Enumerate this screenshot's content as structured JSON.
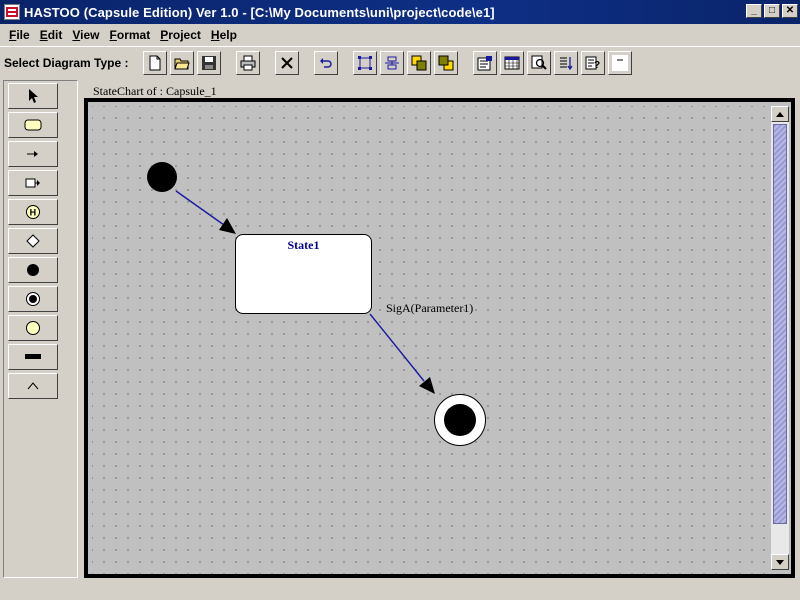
{
  "titlebar": {
    "title": "HASTOO (Capsule Edition) Ver 1.0 - [C:\\My Documents\\uni\\project\\code\\e1]",
    "minimize_glyph": "_",
    "maximize_glyph": "□",
    "close_glyph": "✕"
  },
  "menubar": {
    "items": [
      {
        "first": "F",
        "rest": "ile"
      },
      {
        "first": "E",
        "rest": "dit"
      },
      {
        "first": "V",
        "rest": "iew"
      },
      {
        "first": "F",
        "rest": "ormat"
      },
      {
        "first": "P",
        "rest": "roject"
      },
      {
        "first": "H",
        "rest": "elp"
      }
    ]
  },
  "toolbar": {
    "label": "Select Diagram Type :",
    "icons": [
      "new-file-icon",
      "open-folder-icon",
      "save-disk-icon",
      "print-icon",
      "delete-x-icon",
      "undo-icon",
      "select-group-icon",
      "align-icon",
      "bring-front-icon",
      "send-back-icon",
      "properties-icon",
      "grid-icon",
      "zoom-icon",
      "sort-icon",
      "help-icon",
      "blank-icon"
    ]
  },
  "palette": {
    "tools": [
      "pointer-icon",
      "state-icon",
      "transition-icon",
      "self-transition-icon",
      "history-icon",
      "choice-icon",
      "initial-icon",
      "final-icon",
      "note-icon",
      "fork-join-icon",
      "up-caret-icon"
    ]
  },
  "diagram": {
    "title": "StateChart of : Capsule_1",
    "state": {
      "name": "State1"
    },
    "transition_label": "SigA(Parameter1)",
    "colors": {
      "arrow": "#1a1aa0",
      "state_name": "#00008b"
    }
  }
}
